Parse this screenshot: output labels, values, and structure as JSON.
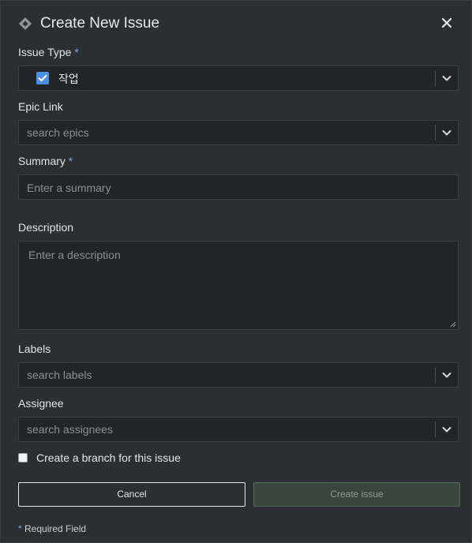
{
  "dialog": {
    "title": "Create New Issue"
  },
  "fields": {
    "issue_type": {
      "label": "Issue Type",
      "required_mark": "*",
      "value": "작업"
    },
    "epic_link": {
      "label": "Epic Link",
      "placeholder": "search epics"
    },
    "summary": {
      "label": "Summary",
      "required_mark": "*",
      "placeholder": "Enter a summary"
    },
    "description": {
      "label": "Description",
      "placeholder": "Enter a description"
    },
    "labels": {
      "label": "Labels",
      "placeholder": "search labels"
    },
    "assignee": {
      "label": "Assignee",
      "placeholder": "search assignees"
    }
  },
  "branch": {
    "label": "Create a branch for this issue",
    "checked": false
  },
  "buttons": {
    "cancel": "Cancel",
    "create": "Create issue"
  },
  "footnote": {
    "mark": "*",
    "text": "Required Field"
  },
  "colors": {
    "accent": "#4a90e2",
    "required": "#7aa3e6",
    "create_bg": "#39453d"
  },
  "icons": {
    "logo": "jira-diamond-icon",
    "close": "close-icon",
    "dropdown": "chevron-down-icon",
    "check": "check-icon"
  }
}
